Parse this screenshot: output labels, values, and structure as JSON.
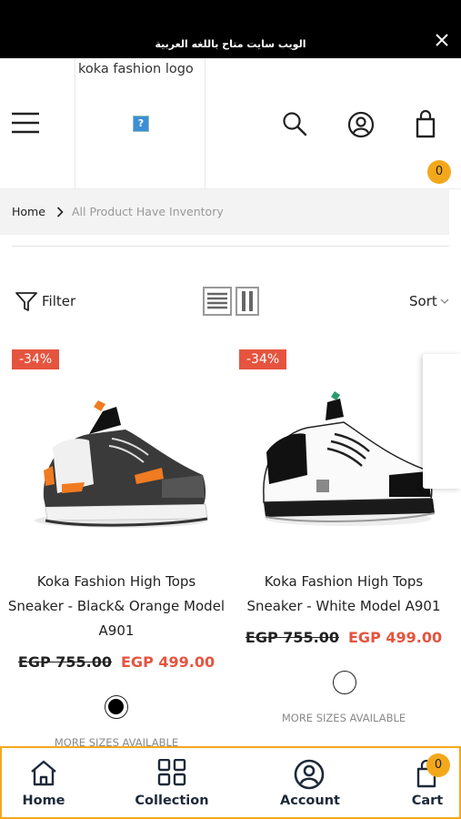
{
  "announcement": {
    "text": "الويب سايت متاح باللغه العربية"
  },
  "header": {
    "logo_alt": "koka fashion logo",
    "cart_count": "0"
  },
  "breadcrumb": {
    "home": "Home",
    "current": "All Product Have Inventory"
  },
  "toolbar": {
    "filter_label": "Filter",
    "sort_label": "Sort"
  },
  "products": [
    {
      "discount": "-34%",
      "title": "Koka Fashion High Tops Sneaker - Black& Orange Model A901",
      "old_price": "EGP 755.00",
      "new_price": "EGP 499.00",
      "swatch_color": "#000000",
      "more_sizes": "MORE SIZES AVAILABLE"
    },
    {
      "discount": "-34%",
      "title": "Koka Fashion High Tops Sneaker - White Model A901",
      "old_price": "EGP 755.00",
      "new_price": "EGP 499.00",
      "swatch_color": "#ffffff",
      "more_sizes": "MORE SIZES AVAILABLE"
    }
  ],
  "bottom_nav": {
    "home": "Home",
    "collection": "Collection",
    "account": "Account",
    "cart": "Cart",
    "cart_count": "0"
  },
  "colors": {
    "accent": "#f3a81c",
    "sale": "#e5543f",
    "nav_text": "#1e2a3a"
  }
}
